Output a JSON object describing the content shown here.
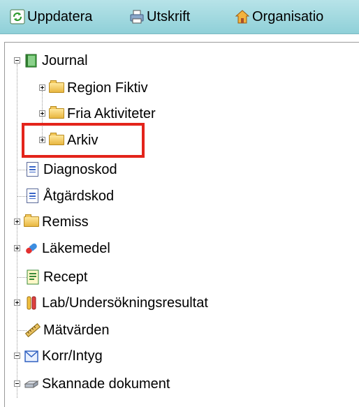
{
  "toolbar": {
    "refresh_label": "Uppdatera",
    "print_label": "Utskrift",
    "org_label": "Organisatio"
  },
  "tree": {
    "journal": "Journal",
    "region": "Region Fiktiv",
    "fria": "Fria Aktiviteter",
    "arkiv": "Arkiv",
    "diagnoskod": "Diagnoskod",
    "atgardskod": "Åtgärdskod",
    "remiss": "Remiss",
    "lakemedel": "Läkemedel",
    "recept": "Recept",
    "lab": "Lab/Undersökningsresultat",
    "matvarden": "Mätvärden",
    "korr": "Korr/Intyg",
    "skannade": "Skannade dokument"
  },
  "colors": {
    "toolbar_bg": "#a6dbe1",
    "highlight": "#e3241b"
  }
}
